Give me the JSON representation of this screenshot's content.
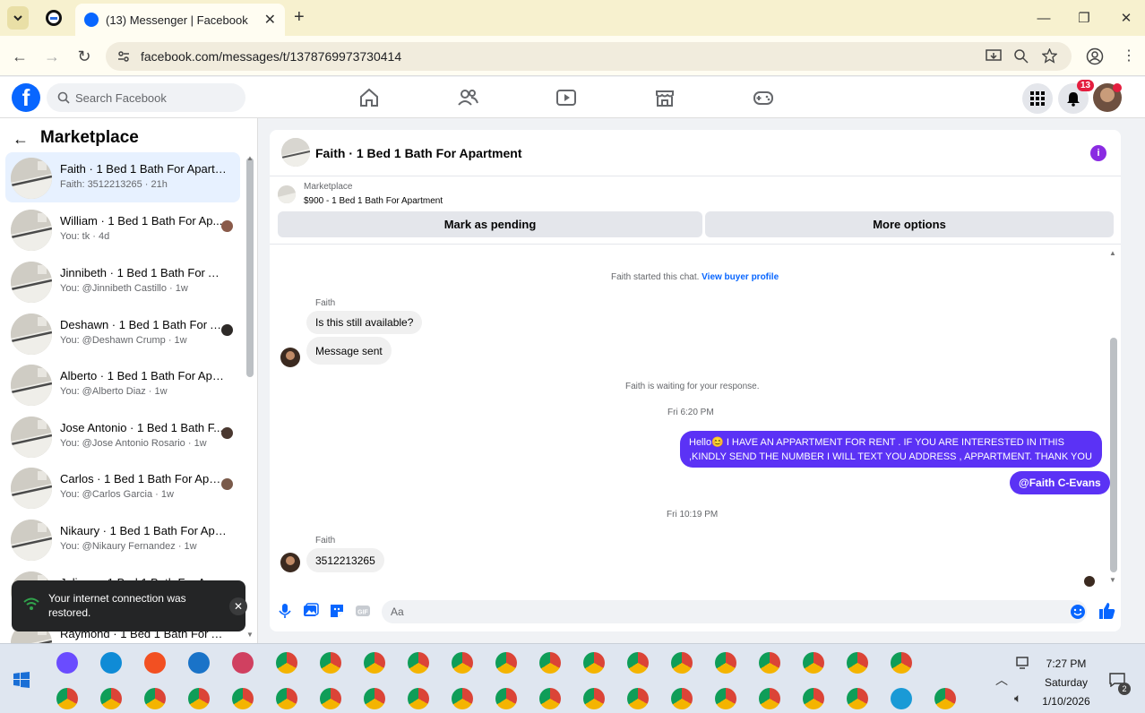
{
  "browser": {
    "tab_title": "(13) Messenger | Facebook",
    "url": "facebook.com/messages/t/1378769973730414"
  },
  "fb": {
    "search_placeholder": "Search Facebook",
    "notifications_count": "13",
    "brand_color": "#0866ff"
  },
  "sidebar": {
    "title": "Marketplace",
    "conversations": [
      {
        "name": "Faith · 1 Bed 1 Bath For Apartme...",
        "preview": "Faith: 3512213265 · 21h",
        "active": true
      },
      {
        "name": "William · 1 Bed 1 Bath For Ap...",
        "preview": "You: tk · 4d"
      },
      {
        "name": "Jinnibeth · 1 Bed 1 Bath For Apa...",
        "preview": "You: @Jinnibeth Castillo · 1w"
      },
      {
        "name": "Deshawn · 1 Bed 1 Bath For A...",
        "preview": "You: @Deshawn Crump · 1w"
      },
      {
        "name": "Alberto · 1 Bed 1 Bath For Apart...",
        "preview": "You: @Alberto Diaz · 1w"
      },
      {
        "name": "Jose Antonio · 1 Bed 1 Bath F...",
        "preview": "You: @Jose Antonio Rosario · 1w"
      },
      {
        "name": "Carlos · 1 Bed 1 Bath For Apar...",
        "preview": "You: @Carlos Garcia · 1w"
      },
      {
        "name": "Nikaury · 1 Bed 1 Bath For Apart...",
        "preview": "You: @Nikaury Fernandez · 1w"
      },
      {
        "name": "Juliana · 1 Bed 1 Bath For A...",
        "preview": ""
      },
      {
        "name": "Raymond · 1 Bed 1 Bath For A...",
        "preview": ""
      }
    ]
  },
  "toast": {
    "message": "Your internet connection was restored."
  },
  "chat": {
    "title": "Faith · 1 Bed 1 Bath For Apartment",
    "listing_label": "Marketplace",
    "listing_price_title": "$900 - 1 Bed 1 Bath For Apartment",
    "mark_pending": "Mark as pending",
    "more_options": "More options",
    "started_text": "Faith started this chat.",
    "view_profile": "View buyer profile",
    "sender1": "Faith",
    "msg1": "Is this still available?",
    "msg2": "Message sent",
    "waiting_text": "Faith is waiting for your response.",
    "time1": "Fri 6:20 PM",
    "out_line1": "Hello😊 I HAVE AN APPARTMENT  FOR RENT . IF YOU ARE INTERESTED IN ITHIS",
    "out_line2": ",KINDLY SEND THE NUMBER I WILL TEXT YOU ADDRESS , APPARTMENT. THANK YOU",
    "out_mention": "@Faith C-Evans",
    "time2": "Fri 10:19 PM",
    "sender2": "Faith",
    "msg3": "3512213265",
    "input_placeholder": "Aa",
    "accent_color": "#5b32f5"
  },
  "taskbar": {
    "time": "7:27 PM",
    "day": "Saturday",
    "date": "1/10/2026",
    "notif_count": "2"
  }
}
